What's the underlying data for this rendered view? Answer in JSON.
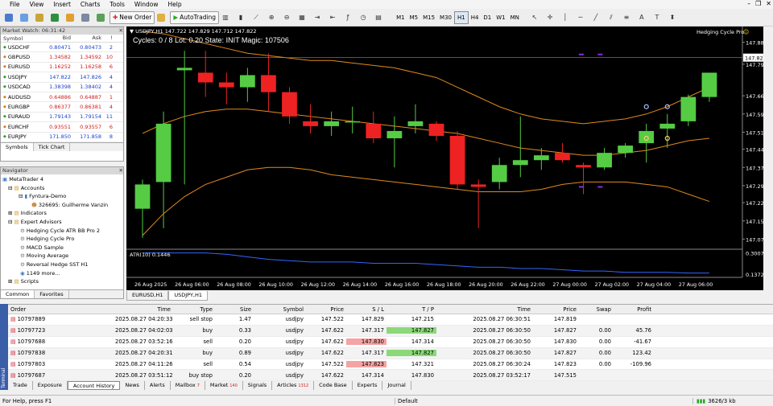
{
  "menu": [
    "File",
    "View",
    "Insert",
    "Charts",
    "Tools",
    "Window",
    "Help"
  ],
  "toolbar": {
    "new_order": "New Order",
    "autotrading": "AutoTrading",
    "timeframes": [
      "M1",
      "M5",
      "M15",
      "M30",
      "H1",
      "H4",
      "D1",
      "W1",
      "MN"
    ],
    "active_tf": "H1"
  },
  "market_watch": {
    "title": "Market Watch: 06:31:42",
    "headers": [
      "Symbol",
      "Bid",
      "Ask",
      "!"
    ],
    "rows": [
      {
        "symbol": "USDCHF",
        "bid": "0.80471",
        "ask": "0.80473",
        "spread": "2",
        "dir": "up"
      },
      {
        "symbol": "GBPUSD",
        "bid": "1.34582",
        "ask": "1.34592",
        "spread": "10",
        "dir": "dn"
      },
      {
        "symbol": "EURUSD",
        "bid": "1.16252",
        "ask": "1.16258",
        "spread": "6",
        "dir": "dn"
      },
      {
        "symbol": "USDJPY",
        "bid": "147.822",
        "ask": "147.826",
        "spread": "4",
        "dir": "up"
      },
      {
        "symbol": "USDCAD",
        "bid": "1.38398",
        "ask": "1.38402",
        "spread": "4",
        "dir": "up"
      },
      {
        "symbol": "AUDUSD",
        "bid": "0.64886",
        "ask": "0.64887",
        "spread": "1",
        "dir": "dn"
      },
      {
        "symbol": "EURGBP",
        "bid": "0.86377",
        "ask": "0.86381",
        "spread": "4",
        "dir": "dn"
      },
      {
        "symbol": "EURAUD",
        "bid": "1.79143",
        "ask": "1.79154",
        "spread": "11",
        "dir": "up"
      },
      {
        "symbol": "EURCHF",
        "bid": "0.93551",
        "ask": "0.93557",
        "spread": "6",
        "dir": "dn"
      },
      {
        "symbol": "EURJPY",
        "bid": "171.850",
        "ask": "171.858",
        "spread": "8",
        "dir": "up"
      }
    ],
    "tabs": [
      "Symbols",
      "Tick Chart"
    ]
  },
  "navigator": {
    "title": "Navigator",
    "items": [
      "MetaTrader 4",
      "Accounts",
      "Fyntura-Demo",
      "326695: Guilherme Vanzin",
      "Indicators",
      "Expert Advisors",
      "Hedging Cycle ATR BB Pro 2",
      "Hedging Cycle Pro",
      "MACD Sample",
      "Moving Average",
      "Reversal Hedge SST H1",
      "1149 more...",
      "Scripts"
    ],
    "tabs": [
      "Common",
      "Favorites"
    ]
  },
  "chart": {
    "header": "USDJPY,H1  147.722 147.829 147.712 147.822",
    "status": "Cycles: 0 / 8  Lot: 0.20  State: INIT  Magic: 107506",
    "ea_name": "Hedging Cycle Pro",
    "ea_face": "☺",
    "current_price": "147.822",
    "price_labels": [
      "147.885",
      "147.795",
      "147.665",
      "147.590",
      "147.515",
      "147.445",
      "147.370",
      "147.295",
      "147.225",
      "147.150",
      "147.075"
    ],
    "atr_label": "ATR(10) 0.1446",
    "atr_ticks": [
      "0.3007",
      "0.1372"
    ],
    "time_labels": [
      "26 Aug 2025",
      "26 Aug 06:00",
      "26 Aug 08:00",
      "26 Aug 10:00",
      "26 Aug 12:00",
      "26 Aug 14:00",
      "26 Aug 16:00",
      "26 Aug 18:00",
      "26 Aug 20:00",
      "26 Aug 22:00",
      "27 Aug 00:00",
      "27 Aug 02:00",
      "27 Aug 04:00",
      "27 Aug 06:00"
    ],
    "tabs": [
      "EURUSD,H1",
      "USDJPY,H1"
    ],
    "active_tab": "USDJPY,H1",
    "colors": {
      "bull": "#55cc44",
      "bear": "#ee2222",
      "band": "#e08a1e",
      "atr": "#3366ff",
      "marker": "#8a2be2"
    }
  },
  "chart_data": {
    "type": "candlestick",
    "symbol": "USDJPY",
    "timeframe": "H1",
    "ylim": [
      147.04,
      147.95
    ],
    "candles": [
      {
        "o": 147.2,
        "h": 147.32,
        "l": 147.08,
        "c": 147.3
      },
      {
        "o": 147.31,
        "h": 147.6,
        "l": 147.12,
        "c": 147.55
      },
      {
        "o": 147.77,
        "h": 147.85,
        "l": 147.3,
        "c": 147.78
      },
      {
        "o": 147.76,
        "h": 147.85,
        "l": 147.66,
        "c": 147.72
      },
      {
        "o": 147.72,
        "h": 147.76,
        "l": 147.63,
        "c": 147.7
      },
      {
        "o": 147.7,
        "h": 147.78,
        "l": 147.64,
        "c": 147.75
      },
      {
        "o": 147.75,
        "h": 147.84,
        "l": 147.6,
        "c": 147.68
      },
      {
        "o": 147.68,
        "h": 147.7,
        "l": 147.55,
        "c": 147.58
      },
      {
        "o": 147.56,
        "h": 147.63,
        "l": 147.51,
        "c": 147.54
      },
      {
        "o": 147.54,
        "h": 147.6,
        "l": 147.5,
        "c": 147.56
      },
      {
        "o": 147.56,
        "h": 147.62,
        "l": 147.51,
        "c": 147.56
      },
      {
        "o": 147.55,
        "h": 147.6,
        "l": 147.47,
        "c": 147.49
      },
      {
        "o": 147.49,
        "h": 147.58,
        "l": 147.37,
        "c": 147.52
      },
      {
        "o": 147.54,
        "h": 147.63,
        "l": 147.51,
        "c": 147.56
      },
      {
        "o": 147.55,
        "h": 147.56,
        "l": 147.48,
        "c": 147.5
      },
      {
        "o": 147.5,
        "h": 147.52,
        "l": 147.28,
        "c": 147.3
      },
      {
        "o": 147.3,
        "h": 147.32,
        "l": 147.12,
        "c": 147.29
      },
      {
        "o": 147.31,
        "h": 147.41,
        "l": 147.28,
        "c": 147.38
      },
      {
        "o": 147.38,
        "h": 147.58,
        "l": 147.33,
        "c": 147.4
      },
      {
        "o": 147.4,
        "h": 147.45,
        "l": 147.36,
        "c": 147.42
      },
      {
        "o": 147.43,
        "h": 147.47,
        "l": 147.39,
        "c": 147.4
      },
      {
        "o": 147.38,
        "h": 147.39,
        "l": 147.26,
        "c": 147.37
      },
      {
        "o": 147.37,
        "h": 147.45,
        "l": 147.36,
        "c": 147.43
      },
      {
        "o": 147.43,
        "h": 147.47,
        "l": 147.41,
        "c": 147.46
      },
      {
        "o": 147.47,
        "h": 147.55,
        "l": 147.39,
        "c": 147.52
      },
      {
        "o": 147.53,
        "h": 147.59,
        "l": 147.45,
        "c": 147.55
      },
      {
        "o": 147.56,
        "h": 147.67,
        "l": 147.54,
        "c": 147.66
      },
      {
        "o": 147.66,
        "h": 147.75,
        "l": 147.64,
        "c": 147.76
      }
    ],
    "bb_upper": [
      147.93,
      147.92,
      147.9,
      147.88,
      147.86,
      147.84,
      147.83,
      147.82,
      147.81,
      147.81,
      147.8,
      147.79,
      147.78,
      147.76,
      147.74,
      147.7,
      147.66,
      147.62,
      147.59,
      147.57,
      147.56,
      147.55,
      147.56,
      147.57,
      147.59,
      147.62,
      147.66,
      147.7
    ],
    "bb_middle": [
      147.51,
      147.55,
      147.58,
      147.6,
      147.61,
      147.61,
      147.6,
      147.59,
      147.58,
      147.57,
      147.56,
      147.55,
      147.54,
      147.53,
      147.52,
      147.51,
      147.49,
      147.47,
      147.45,
      147.44,
      147.43,
      147.42,
      147.42,
      147.43,
      147.44,
      147.46,
      147.48,
      147.49
    ],
    "bb_lower": [
      147.09,
      147.18,
      147.25,
      147.3,
      147.33,
      147.36,
      147.37,
      147.37,
      147.36,
      147.34,
      147.33,
      147.32,
      147.31,
      147.3,
      147.29,
      147.28,
      147.27,
      147.27,
      147.27,
      147.28,
      147.3,
      147.31,
      147.31,
      147.31,
      147.3,
      147.29,
      147.26,
      147.23
    ],
    "atr": [
      0.3,
      0.3,
      0.3,
      0.3,
      0.29,
      0.27,
      0.25,
      0.24,
      0.23,
      0.23,
      0.23,
      0.22,
      0.22,
      0.22,
      0.21,
      0.2,
      0.19,
      0.19,
      0.18,
      0.18,
      0.17,
      0.16,
      0.16,
      0.15,
      0.15,
      0.15,
      0.145,
      0.1446
    ],
    "atr_ylim": [
      0.13,
      0.31
    ]
  },
  "orders": {
    "headers": [
      "Order",
      "Time",
      "Type",
      "Size",
      "Symbol",
      "Price",
      "S / L",
      "T / P",
      "Time",
      "Price",
      "Swap",
      "Profit"
    ],
    "rows": [
      {
        "order": "10797889",
        "time": "2025.08.27 04:20:33",
        "type": "sell stop",
        "size": "1.47",
        "symbol": "usdjpy",
        "price": "147.522",
        "sl": "147.829",
        "tp": "147.215",
        "ctime": "2025.08.27 06:30:51",
        "cprice": "147.819",
        "swap": "",
        "profit": "",
        "slhl": "",
        "tphl": ""
      },
      {
        "order": "10797723",
        "time": "2025.08.27 04:02:03",
        "type": "buy",
        "size": "0.33",
        "symbol": "usdjpy",
        "price": "147.622",
        "sl": "147.317",
        "tp": "147.827",
        "ctime": "2025.08.27 06:30:50",
        "cprice": "147.827",
        "swap": "0.00",
        "profit": "45.76",
        "slhl": "",
        "tphl": "grn"
      },
      {
        "order": "10797688",
        "time": "2025.08.27 03:52:16",
        "type": "sell",
        "size": "0.20",
        "symbol": "usdjpy",
        "price": "147.622",
        "sl": "147.830",
        "tp": "147.314",
        "ctime": "2025.08.27 06:30:50",
        "cprice": "147.830",
        "swap": "0.00",
        "profit": "-41.67",
        "slhl": "red",
        "tphl": ""
      },
      {
        "order": "10797838",
        "time": "2025.08.27 04:20:31",
        "type": "buy",
        "size": "0.89",
        "symbol": "usdjpy",
        "price": "147.622",
        "sl": "147.317",
        "tp": "147.827",
        "ctime": "2025.08.27 06:30:50",
        "cprice": "147.827",
        "swap": "0.00",
        "profit": "123.42",
        "slhl": "",
        "tphl": "grn"
      },
      {
        "order": "10797803",
        "time": "2025.08.27 04:11:26",
        "type": "sell",
        "size": "0.54",
        "symbol": "usdjpy",
        "price": "147.522",
        "sl": "147.823",
        "tp": "147.321",
        "ctime": "2025.08.27 06:30:24",
        "cprice": "147.823",
        "swap": "0.00",
        "profit": "-109.96",
        "slhl": "red",
        "tphl": ""
      },
      {
        "order": "10797687",
        "time": "2025.08.27 03:51:12",
        "type": "buy stop",
        "size": "0.20",
        "symbol": "usdjpy",
        "price": "147.622",
        "sl": "147.314",
        "tp": "147.830",
        "ctime": "2025.08.27 03:52:17",
        "cprice": "147.515",
        "swap": "",
        "profit": "",
        "slhl": "",
        "tphl": ""
      }
    ]
  },
  "terminal": {
    "side_label": "Terminal",
    "tabs": [
      {
        "label": "Trade",
        "badge": ""
      },
      {
        "label": "Exposure",
        "badge": ""
      },
      {
        "label": "Account History",
        "badge": ""
      },
      {
        "label": "News",
        "badge": ""
      },
      {
        "label": "Alerts",
        "badge": ""
      },
      {
        "label": "Mailbox",
        "badge": "7"
      },
      {
        "label": "Market",
        "badge": "140"
      },
      {
        "label": "Signals",
        "badge": ""
      },
      {
        "label": "Articles",
        "badge": "1312"
      },
      {
        "label": "Code Base",
        "badge": ""
      },
      {
        "label": "Experts",
        "badge": ""
      },
      {
        "label": "Journal",
        "badge": ""
      }
    ],
    "active": "Account History"
  },
  "status": {
    "help": "For Help, press F1",
    "profile": "Default",
    "conn": "3626/3 kb"
  }
}
